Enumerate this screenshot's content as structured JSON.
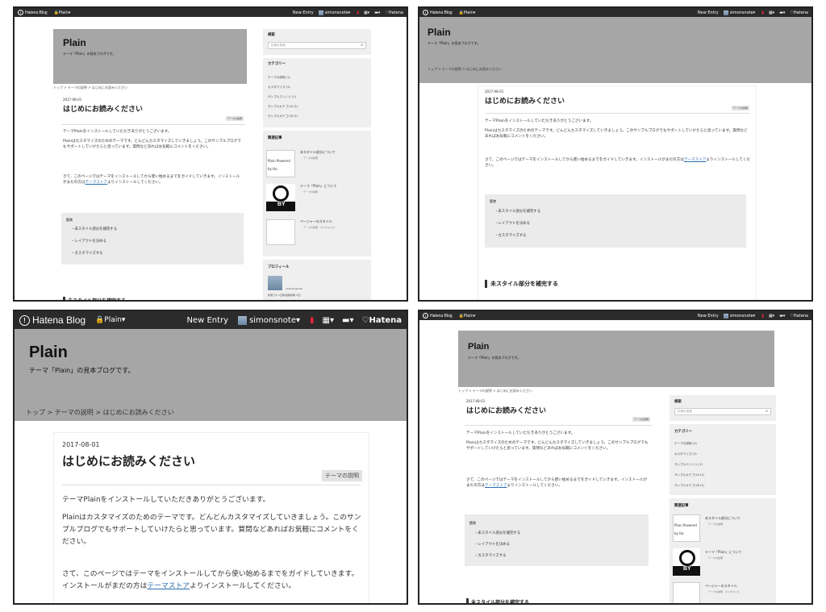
{
  "topbar": {
    "logo_text": "Hatena Blog",
    "blog_menu": "Plain",
    "new_entry": "New Entry",
    "user": "simonsnote",
    "hatena": "Hatena"
  },
  "blog": {
    "title": "Plain",
    "subtitle": "テーマ「Plain」の見本ブログです。"
  },
  "breadcrumb": {
    "top": "トップ",
    "sep": ">",
    "category": "テーマの説明",
    "page": "はじめにお読みください"
  },
  "article": {
    "date": "2017-08-01",
    "title": "はじめにお読みください",
    "category": "テーマの説明",
    "p1": "テーマPlainをインストールしていただきありがとうございます。",
    "p2": "Plainはカスタマイズのためのテーマです。どんどんカスタマイズしていきましょう。このサンプルブログでもサポートしていけたらと思っています。質問などあればお気軽にコメントをください。",
    "p3_pre": "さて、このページではテーマをインストールしてから使い始めるまでをガイドしていきます。インストールがまだの方は",
    "p3_link": "テーマストア",
    "p3_post": "よりインストールしてください。",
    "section_heading": "未スタイル部分を補完する"
  },
  "toc": {
    "heading": "目次",
    "items": [
      "・未スタイル部分を補完する",
      "・レイアウトを決める",
      "・カスタマイズする"
    ]
  },
  "sidebar": {
    "search_heading": "検索",
    "search_placeholder": "記事を検索",
    "category_heading": "カテゴリー",
    "categories": [
      "テーマの説明 (1)",
      "カスタマイズ (1)",
      "サンプルエントリ (1)",
      "サンプルカテゴリA (1)",
      "サンプルカテゴリB (1)"
    ],
    "related_heading": "関連記事",
    "related": [
      {
        "title": "未スタイル部分について",
        "sub": "テーマの説明",
        "thumb": "Plain Powered by Ha"
      },
      {
        "title": "テーマ「Plain」について",
        "sub": "テーマの説明",
        "thumb": "BY"
      },
      {
        "title": "ページャーのスタイル",
        "sub": "テーマの説明　カスタマイズ",
        "thumb": ""
      }
    ],
    "profile_heading": "プロフィール",
    "profile_name": "id:simonsnote",
    "profile_sub": "読者です 1日前(最終投稿 1日)"
  },
  "icons": {
    "search": "search-icon",
    "bookmark": "bookmark-icon",
    "apps": "apps-icon",
    "comment": "comment-icon",
    "cc": "cc-icon"
  },
  "colors": {
    "topbar": "#2b2b2b",
    "banner": "#a6a6a6",
    "accent_bookmark": "#e0243b",
    "link": "#2a6db0"
  }
}
